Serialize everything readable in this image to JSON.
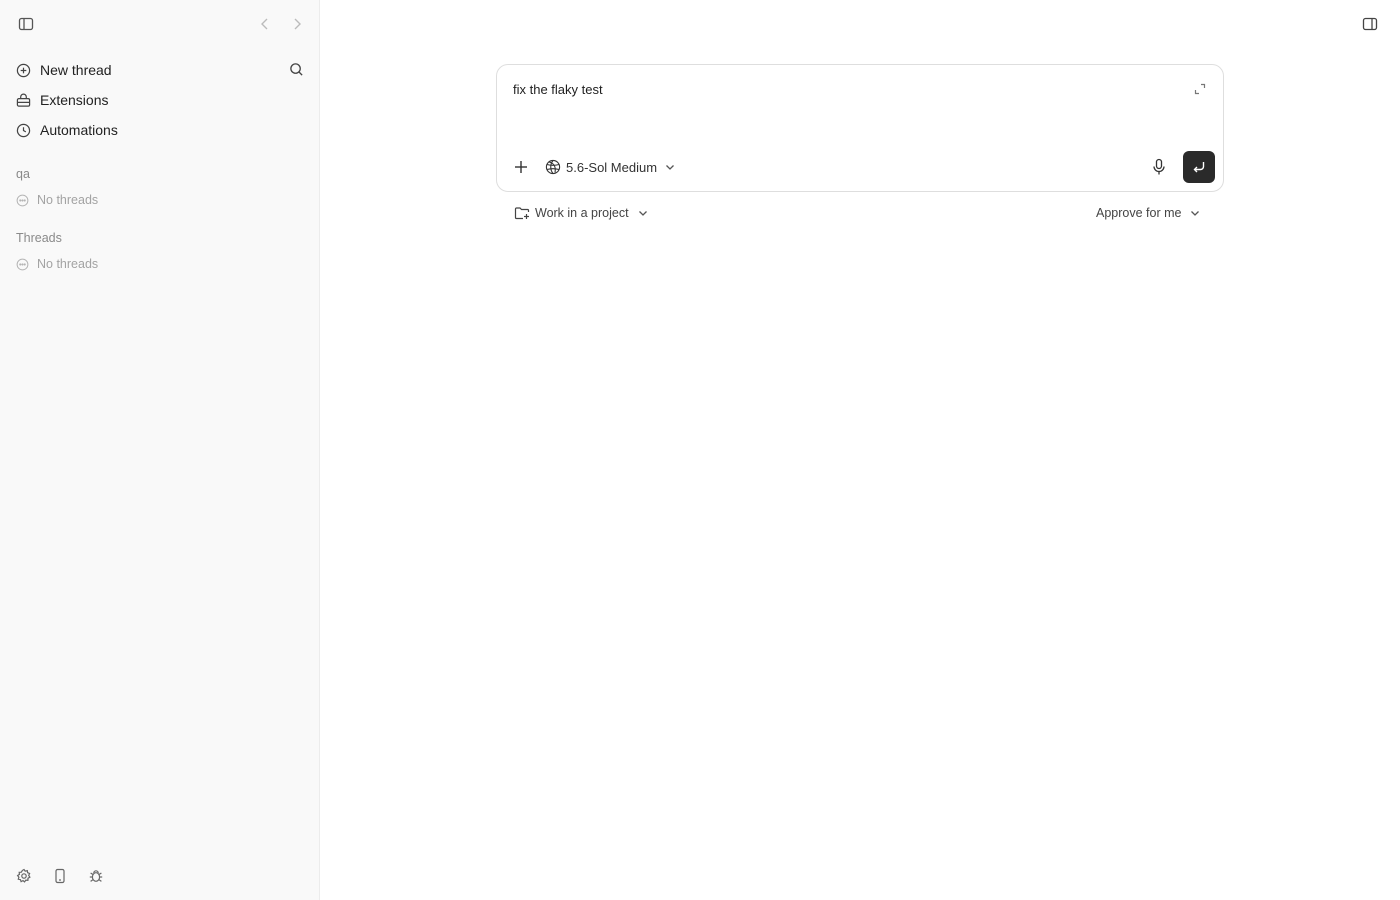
{
  "sidebar": {
    "nav": [
      {
        "label": "New thread",
        "icon": "plus-circle-icon"
      },
      {
        "label": "Extensions",
        "icon": "extensions-icon"
      },
      {
        "label": "Automations",
        "icon": "clock-icon"
      }
    ],
    "sections": [
      {
        "title": "qa",
        "empty_label": "No threads"
      },
      {
        "title": "Threads",
        "empty_label": "No threads"
      }
    ],
    "footer_icons": [
      "settings-icon",
      "mobile-icon",
      "bug-icon"
    ]
  },
  "composer": {
    "input_value": "fix the flaky test",
    "model_label": "5.6-Sol Medium"
  },
  "project_selector": {
    "label": "Work in a project"
  },
  "approval_selector": {
    "label": "Approve for me"
  }
}
